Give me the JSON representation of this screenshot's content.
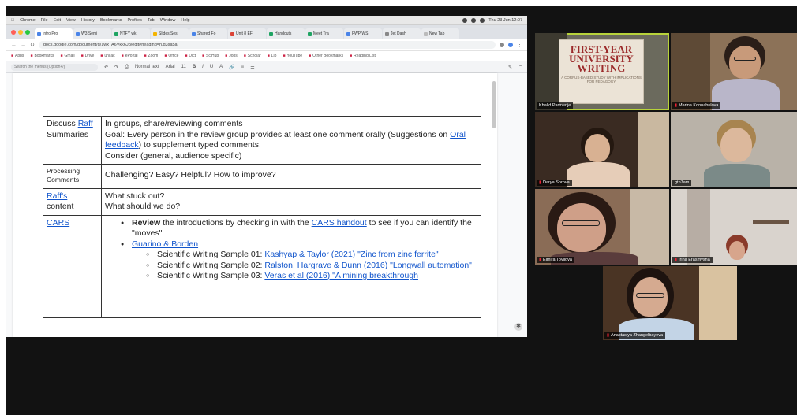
{
  "mac_menubar": {
    "items": [
      "Chrome",
      "File",
      "Edit",
      "View",
      "History",
      "Bookmarks",
      "Profiles",
      "Tab",
      "Window",
      "Help"
    ],
    "clock": "Thu 23 Jun 12:07"
  },
  "browser": {
    "tabs": [
      {
        "label": "Intro Proj",
        "active": true
      },
      {
        "label": "W3 Semi",
        "active": false
      },
      {
        "label": "NTFY wk",
        "active": false
      },
      {
        "label": "Slides Ses",
        "active": false
      },
      {
        "label": "Shared Fo",
        "active": false
      },
      {
        "label": "Unit 8 EF",
        "active": false
      },
      {
        "label": "Handouts",
        "active": false
      },
      {
        "label": "Meet Tra",
        "active": false
      },
      {
        "label": "FWP WS",
        "active": false
      },
      {
        "label": "Jet Dash",
        "active": false
      },
      {
        "label": "New Tab",
        "active": false
      }
    ],
    "url": "docs.google.com/document/d/1wxTA6Vkk6Jb/edit#heading=h.d3sa5a",
    "bookmarks": [
      "Apps",
      "Bookmarks",
      "Gmail",
      "Drive",
      "uni.ac",
      "ePortal",
      "Zoom",
      "Office",
      "Dict",
      "SciHub",
      "Jobs",
      "Scholar",
      "Lib",
      "YouTube",
      "Other Bookmarks",
      "Reading List"
    ],
    "menu_search_placeholder": "Search the menus (Option+/)",
    "toolbar_style": "Normal text",
    "toolbar_font": "Arial",
    "toolbar_size": "11"
  },
  "table": {
    "rows": [
      {
        "col1_link": "Raff",
        "col1_before": "Discuss ",
        "col1_after": "Summaries",
        "line1": "In groups, share/reviewing comments",
        "line2_before": "Goal: Every person in the review group provides at least one comment orally (Suggestions on ",
        "line2_link": "Oral feedback",
        "line2_after": ") to supplement typed comments.",
        "line3": "Consider (general, audience specific)"
      },
      {
        "col1": "Processing Comments",
        "text": "Challenging? Easy? Helpful? How to improve?"
      },
      {
        "col1_link": "Raff's",
        "col1_after": "content",
        "line1": "What stuck out?",
        "line2": "What should we do?"
      },
      {
        "col1_link": "CARS",
        "b1_bold": "Review",
        "b1_before": " the introductions by checking in with the ",
        "b1_link": "CARS handout",
        "b1_after": " to see if you can identify the \"moves\"",
        "b2_link": "Guarino & Borden",
        "samples": [
          {
            "prefix": "Scientific Writing Sample 01: ",
            "link": "Kashyap & Taylor (2021) \"Zinc from zinc ferrite\""
          },
          {
            "prefix": "Scientific Writing Sample 02: ",
            "link": "Ralston, Hargrave & Dunn (2016) \"Longwall automation\""
          },
          {
            "prefix": "Scientific Writing Sample 03: ",
            "link": "Veras et al (2016) \"A mining breakthrough"
          }
        ]
      }
    ]
  },
  "participants": [
    {
      "name": "Khalid Parmenje",
      "speaking": true,
      "muted": false
    },
    {
      "name": "Marina Konnabulova",
      "speaking": false,
      "muted": true
    },
    {
      "name": "Darya Sorova",
      "speaking": false,
      "muted": true
    },
    {
      "name": "gtn7am",
      "speaking": false,
      "muted": false
    },
    {
      "name": "Elmira Toyllova",
      "speaking": false,
      "muted": true
    },
    {
      "name": "Irina Erasmysha",
      "speaking": false,
      "muted": true
    },
    {
      "name": "Anastasiya Zhangelbayeva",
      "speaking": false,
      "muted": true
    }
  ],
  "book": {
    "title_lines": [
      "FIRST-YEAR",
      "UNIVERSITY",
      "WRITING"
    ],
    "subtitle": "A CORPUS-BASED STUDY WITH IMPLICATIONS FOR PEDAGOGY"
  }
}
